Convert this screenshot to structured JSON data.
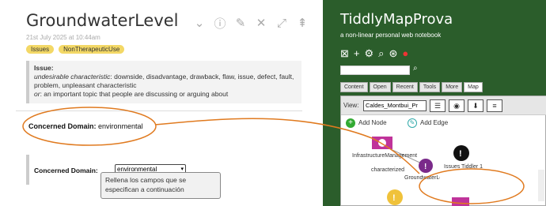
{
  "left": {
    "title": "GroundwaterLevel",
    "date": "21st July 2025 at 10:44am",
    "tags": [
      "Issues",
      "NonTherapeuticUse"
    ],
    "issue": {
      "heading": "Issue:",
      "def1_label": "undesirable characteristic",
      "def1_text": ": downside, disadvantage, drawback, flaw, issue, defect, fault, problem, unpleasant characteristic",
      "def2_label": "or",
      "def2_text": ": an important topic that people are discussing or arguing about"
    },
    "concerned_domain_label": "Concerned Domain:",
    "concerned_domain_value": "environmental",
    "form": {
      "label": "Concerned Domain:",
      "select_value": "environmental"
    },
    "toolbar_icons": [
      "chevron-down-icon",
      "info-icon",
      "edit-icon",
      "close-icon",
      "fullscreen-icon",
      "fold-icon"
    ]
  },
  "right": {
    "title": "TiddlyMapProva",
    "subtitle": "a non-linear personal web notebook",
    "tabs": [
      "Content",
      "Open",
      "Recent",
      "Tools",
      "More",
      "Map"
    ],
    "active_tab": "Map",
    "map": {
      "view_label": "View:",
      "view_value": "Caldes_Montbui_Pr",
      "add_node": "Add Node",
      "add_edge": "Add Edge",
      "nodes": [
        {
          "label": "InfrastructureManagement"
        },
        {
          "label": "Issues Tiddler 1"
        },
        {
          "label": "GroundwaterLevel"
        }
      ],
      "edge_label": "characterized",
      "tooltip": "Rellena los campos que se especifican a continuación"
    }
  },
  "colors": {
    "green_bg": "#2b5d2b",
    "tag_yellow": "#f3d866",
    "annotation_orange": "#e07a1f",
    "node_magenta": "#c0339a"
  }
}
